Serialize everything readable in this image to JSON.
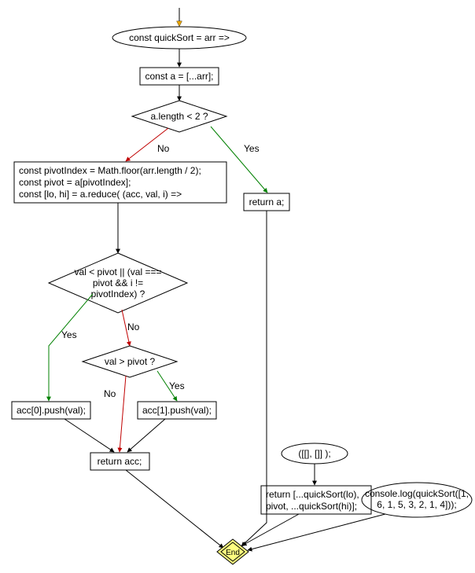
{
  "nodes": {
    "start": "const quickSort = arr =>",
    "copyarr": "const a = [...arr];",
    "lencheck": "a.length < 2 ?",
    "lenYes": "Yes",
    "lenNo": "No",
    "pivotblock_l1": "const pivotIndex = Math.floor(arr.length / 2);",
    "pivotblock_l2": "const pivot = a[pivotIndex];",
    "pivotblock_l3": "const [lo, hi] = a.reduce( (acc, val, i) =>",
    "return_a": "return a;",
    "cond_lo_l1": "val < pivot || (val ===",
    "cond_lo_l2": "pivot && i !=",
    "cond_lo_l3": "pivotIndex) ?",
    "cond_lo_yes": "Yes",
    "cond_lo_no": "No",
    "cond_hi": "val > pivot ?",
    "cond_hi_yes": "Yes",
    "cond_hi_no": "No",
    "push_lo": "acc[0].push(val);",
    "push_hi": "acc[1].push(val);",
    "return_acc": "return acc;",
    "init_tuple": "([[], []] );",
    "return_rec_l1": "return [...quickSort(lo),",
    "return_rec_l2": "pivot, ...quickSort(hi)];",
    "consolelog_l1": "console.log(quickSort([1,",
    "consolelog_l2": "6, 1, 5, 3, 2, 1, 4]));",
    "end": "End"
  },
  "colors": {
    "edge_yes": "#008000",
    "edge_no": "#c00000",
    "edge": "#000000",
    "fill_start": "#ffff80",
    "stroke": "#000000"
  }
}
